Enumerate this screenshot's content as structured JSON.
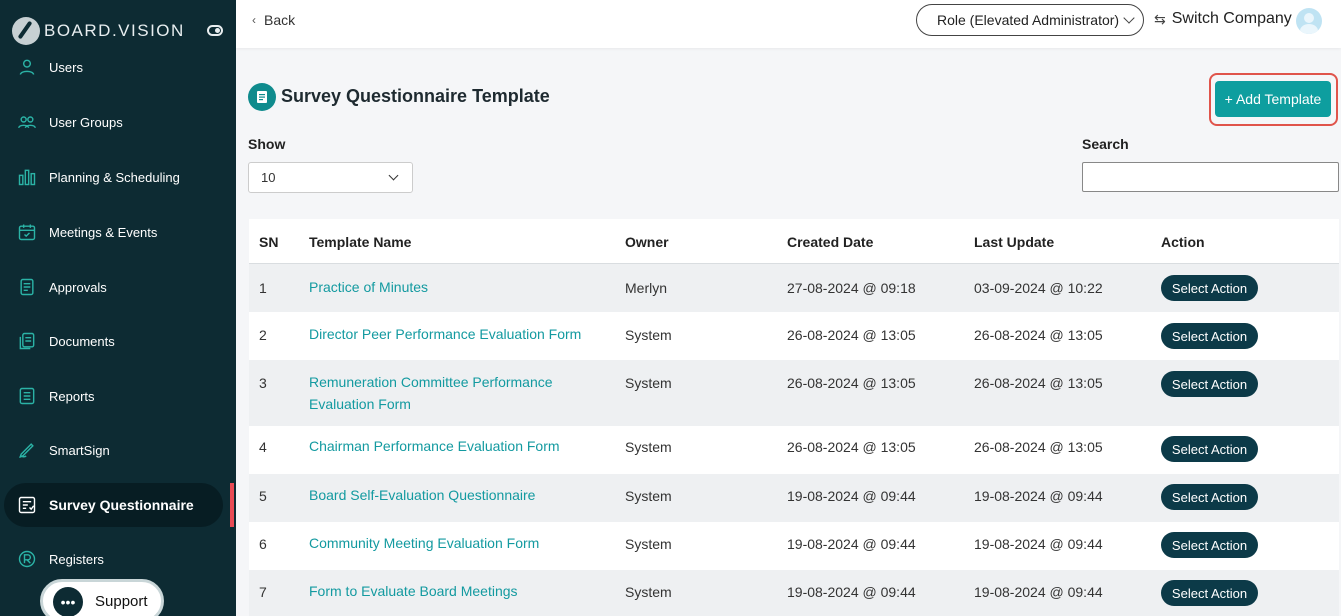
{
  "brand": {
    "name": "BOARD.VISION"
  },
  "sidebar": {
    "items": [
      {
        "label": "Users",
        "icon": "user-icon"
      },
      {
        "label": "User Groups",
        "icon": "users-icon"
      },
      {
        "label": "Planning & Scheduling",
        "icon": "bar-chart-icon"
      },
      {
        "label": "Meetings & Events",
        "icon": "calendar-icon"
      },
      {
        "label": "Approvals",
        "icon": "approvals-icon"
      },
      {
        "label": "Documents",
        "icon": "documents-icon"
      },
      {
        "label": "Reports",
        "icon": "reports-icon"
      },
      {
        "label": "SmartSign",
        "icon": "pen-icon"
      },
      {
        "label": "Survey Questionnaire",
        "icon": "survey-icon",
        "active": true
      },
      {
        "label": "Registers",
        "icon": "registers-icon"
      }
    ],
    "support_label": "Support"
  },
  "topbar": {
    "back_label": "Back",
    "role_label": "Role (Elevated Administrator)",
    "switch_label": "Switch Company"
  },
  "main": {
    "title": "Survey Questionnaire Template",
    "add_button_label": "+ Add Template",
    "show_label": "Show",
    "show_value": "10",
    "search_label": "Search",
    "search_value": "",
    "action_button_label": "Select Action"
  },
  "table": {
    "columns": [
      "SN",
      "Template Name",
      "Owner",
      "Created Date",
      "Last Update",
      "Action"
    ],
    "rows": [
      {
        "sn": "1",
        "name": "Practice of Minutes",
        "owner": "Merlyn",
        "created": "27-08-2024 @ 09:18",
        "updated": "03-09-2024 @ 10:22"
      },
      {
        "sn": "2",
        "name": "Director Peer Performance Evaluation Form",
        "owner": "System",
        "created": "26-08-2024 @ 13:05",
        "updated": "26-08-2024 @ 13:05"
      },
      {
        "sn": "3",
        "name": "Remuneration Committee Performance Evaluation Form",
        "owner": "System",
        "created": "26-08-2024 @ 13:05",
        "updated": "26-08-2024 @ 13:05"
      },
      {
        "sn": "4",
        "name": "Chairman Performance Evaluation Form",
        "owner": "System",
        "created": "26-08-2024 @ 13:05",
        "updated": "26-08-2024 @ 13:05"
      },
      {
        "sn": "5",
        "name": "Board Self-Evaluation Questionnaire",
        "owner": "System",
        "created": "19-08-2024 @ 09:44",
        "updated": "19-08-2024 @ 09:44"
      },
      {
        "sn": "6",
        "name": "Community Meeting Evaluation Form",
        "owner": "System",
        "created": "19-08-2024 @ 09:44",
        "updated": "19-08-2024 @ 09:44"
      },
      {
        "sn": "7",
        "name": "Form to Evaluate Board Meetings",
        "owner": "System",
        "created": "19-08-2024 @ 09:44",
        "updated": "19-08-2024 @ 09:44"
      }
    ]
  },
  "colors": {
    "sidebar_bg": "#0d2b33",
    "accent": "#0e9e9f",
    "link": "#139aa0",
    "action_button": "#0c3a48",
    "highlight": "#e0544b"
  }
}
